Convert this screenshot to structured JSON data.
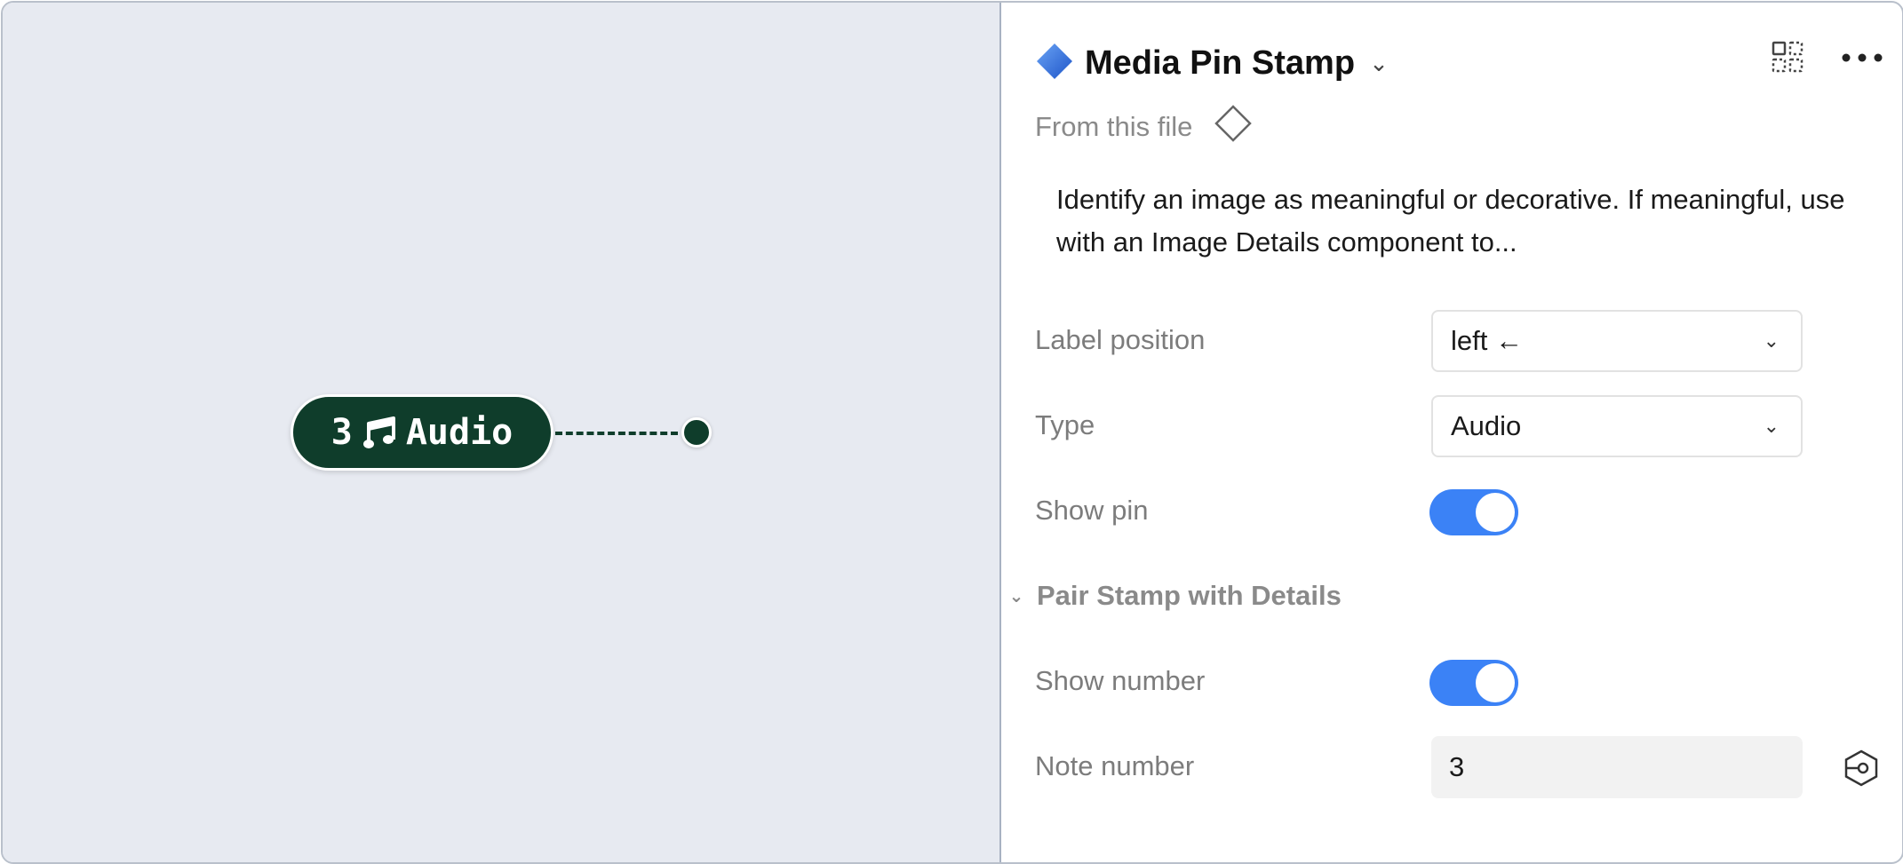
{
  "canvas": {
    "stamp": {
      "number": "3",
      "icon": "music-note-icon",
      "label": "Audio"
    },
    "colors": {
      "stamp_bg": "#0f3d2b",
      "canvas_bg": "#e7eaf1"
    }
  },
  "panel": {
    "component_icon": "diamond-component-icon",
    "title": "Media Pin Stamp",
    "source_label": "From this file",
    "description": "Identify an image as meaningful or decorative. If meaningful, use with an Image Details component to...",
    "properties": {
      "label_position": {
        "label": "Label position",
        "value": "left ←"
      },
      "type": {
        "label": "Type",
        "value": "Audio"
      },
      "show_pin": {
        "label": "Show pin",
        "on": true
      }
    },
    "section": {
      "title": "Pair Stamp with Details",
      "show_number": {
        "label": "Show number",
        "on": true
      },
      "note_number": {
        "label": "Note number",
        "value": "3"
      }
    },
    "colors": {
      "toggle_on": "#3b82f6"
    }
  }
}
